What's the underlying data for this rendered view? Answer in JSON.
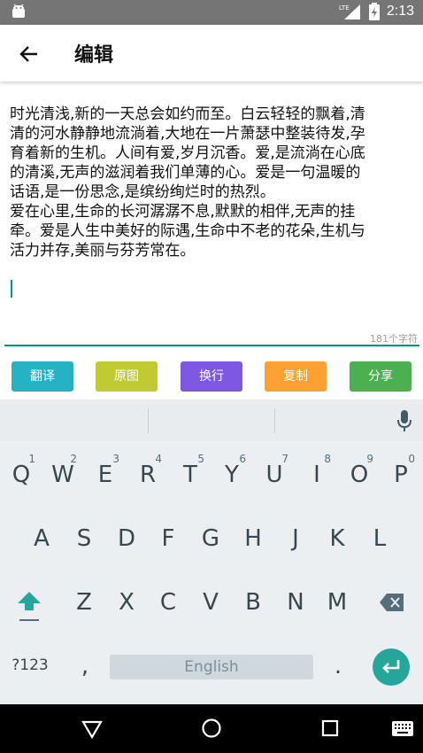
{
  "status_bar": {
    "time": "2:13",
    "network": "LTE"
  },
  "app_bar": {
    "title": "编辑",
    "back_icon": "arrow-left-icon"
  },
  "editor": {
    "text": "时光清浅,新的一天总会如约而至。白云轻轻的飘着,清清的河水静静地流淌着,大地在一片萧瑟中整装待发,孕育着新的生机。人间有爱,岁月沉香。爱,是流淌在心底的清溪,无声的滋润着我们单薄的心。爱是一句温暖的话语,是一份思念,是缤纷绚烂时的热烈。\n爱在心里,生命的长河潺潺不息,默默的相伴,无声的挂牵。爱是人生中美好的际遇,生命中不老的花朵,生机与活力并存,美丽与芬芳常在。",
    "char_count": "181个字符"
  },
  "actions": [
    {
      "label": "翻译",
      "color": "#26b3c1"
    },
    {
      "label": "原图",
      "color": "#c0ca33"
    },
    {
      "label": "换行",
      "color": "#7e57e2"
    },
    {
      "label": "复制",
      "color": "#ffa033"
    },
    {
      "label": "分享",
      "color": "#4caf50"
    }
  ],
  "keyboard": {
    "row1": [
      {
        "key": "Q",
        "hint": "1"
      },
      {
        "key": "W",
        "hint": "2"
      },
      {
        "key": "E",
        "hint": "3"
      },
      {
        "key": "R",
        "hint": "4"
      },
      {
        "key": "T",
        "hint": "5"
      },
      {
        "key": "Y",
        "hint": "6"
      },
      {
        "key": "U",
        "hint": "7"
      },
      {
        "key": "I",
        "hint": "8"
      },
      {
        "key": "O",
        "hint": "9"
      },
      {
        "key": "P",
        "hint": "0"
      }
    ],
    "row2": [
      "A",
      "S",
      "D",
      "F",
      "G",
      "H",
      "J",
      "K",
      "L"
    ],
    "row3": [
      "Z",
      "X",
      "C",
      "V",
      "B",
      "N",
      "M"
    ],
    "symbols_label": "?123",
    "comma": ",",
    "space_label": "English",
    "period": ".",
    "accent_color": "#26a69a"
  },
  "nav_bar": {
    "icons": [
      "back-triangle-icon",
      "home-circle-icon",
      "recents-square-icon",
      "keyboard-icon"
    ]
  }
}
